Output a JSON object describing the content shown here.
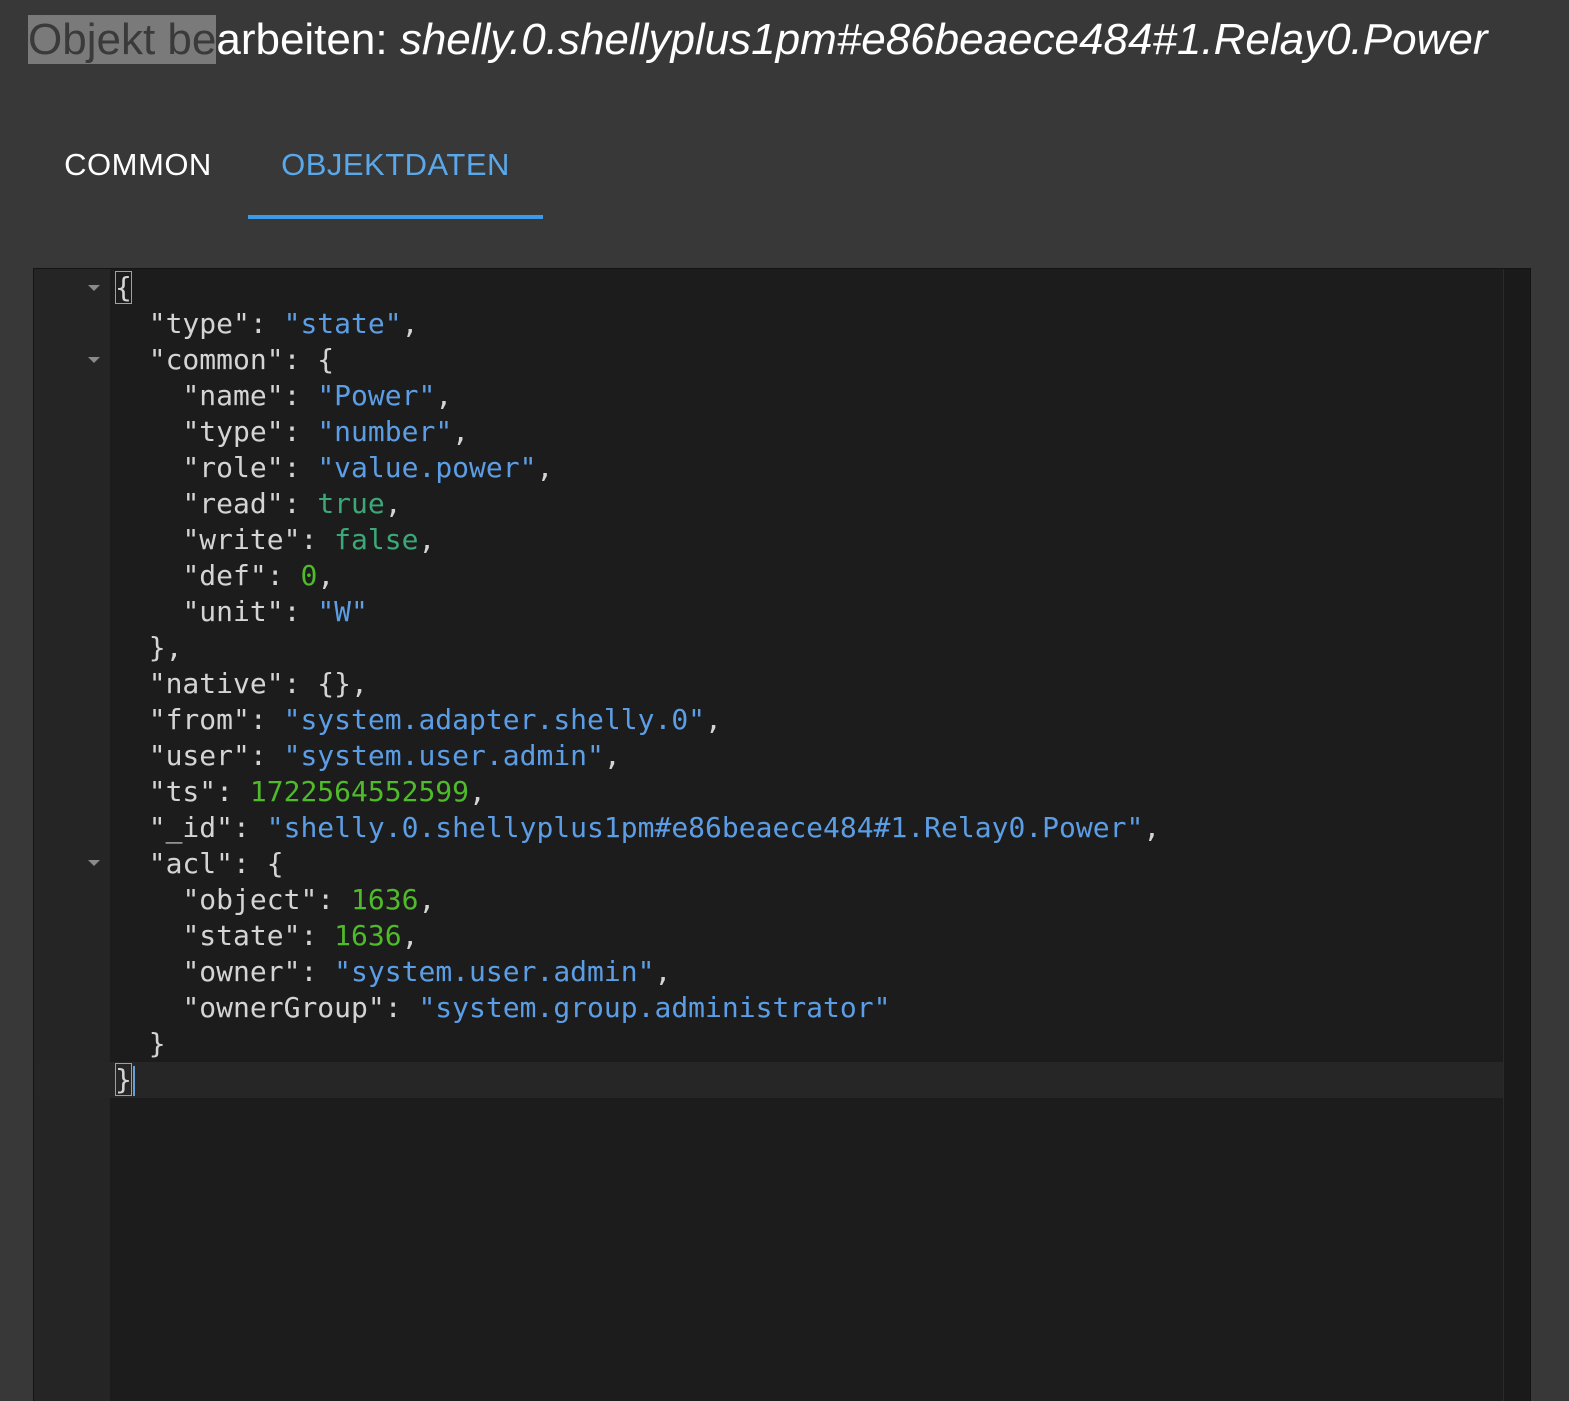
{
  "dialog": {
    "title_selected": "Objekt be",
    "title_rest": "arbeiten: ",
    "object_id": "shelly.0.shellyplus1pm#e86beaece484#1.Relay0.Power"
  },
  "tabs": [
    {
      "label": "COMMON",
      "active": false
    },
    {
      "label": "OBJEKTDATEN",
      "active": true
    }
  ],
  "colors": {
    "background": "#383838",
    "editor_bg": "#1c1c1c",
    "tab_active": "#5aa8ea",
    "json_string": "#5c9ee6",
    "json_number": "#4fba2a",
    "json_boolean": "#3aa877"
  },
  "editor": {
    "brace_open": "{",
    "brace_close": "}",
    "type": {
      "key": "\"type\"",
      "value": "\"state\""
    },
    "common": {
      "key": "\"common\"",
      "name": {
        "key": "\"name\"",
        "value": "\"Power\""
      },
      "type": {
        "key": "\"type\"",
        "value": "\"number\""
      },
      "role": {
        "key": "\"role\"",
        "value": "\"value.power\""
      },
      "read": {
        "key": "\"read\"",
        "value": "true"
      },
      "write": {
        "key": "\"write\"",
        "value": "false"
      },
      "def": {
        "key": "\"def\"",
        "value": "0"
      },
      "unit": {
        "key": "\"unit\"",
        "value": "\"W\""
      }
    },
    "native": {
      "key": "\"native\"",
      "value": "{}"
    },
    "from": {
      "key": "\"from\"",
      "value": "\"system.adapter.shelly.0\""
    },
    "user": {
      "key": "\"user\"",
      "value": "\"system.user.admin\""
    },
    "ts": {
      "key": "\"ts\"",
      "value": "1722564552599"
    },
    "id": {
      "key": "\"_id\"",
      "value": "\"shelly.0.shellyplus1pm#e86beaece484#1.Relay0.Power\""
    },
    "acl": {
      "key": "\"acl\"",
      "object": {
        "key": "\"object\"",
        "value": "1636"
      },
      "state": {
        "key": "\"state\"",
        "value": "1636"
      },
      "owner": {
        "key": "\"owner\"",
        "value": "\"system.user.admin\""
      },
      "ownerGroup": {
        "key": "\"ownerGroup\"",
        "value": "\"system.group.administrator\""
      }
    }
  }
}
